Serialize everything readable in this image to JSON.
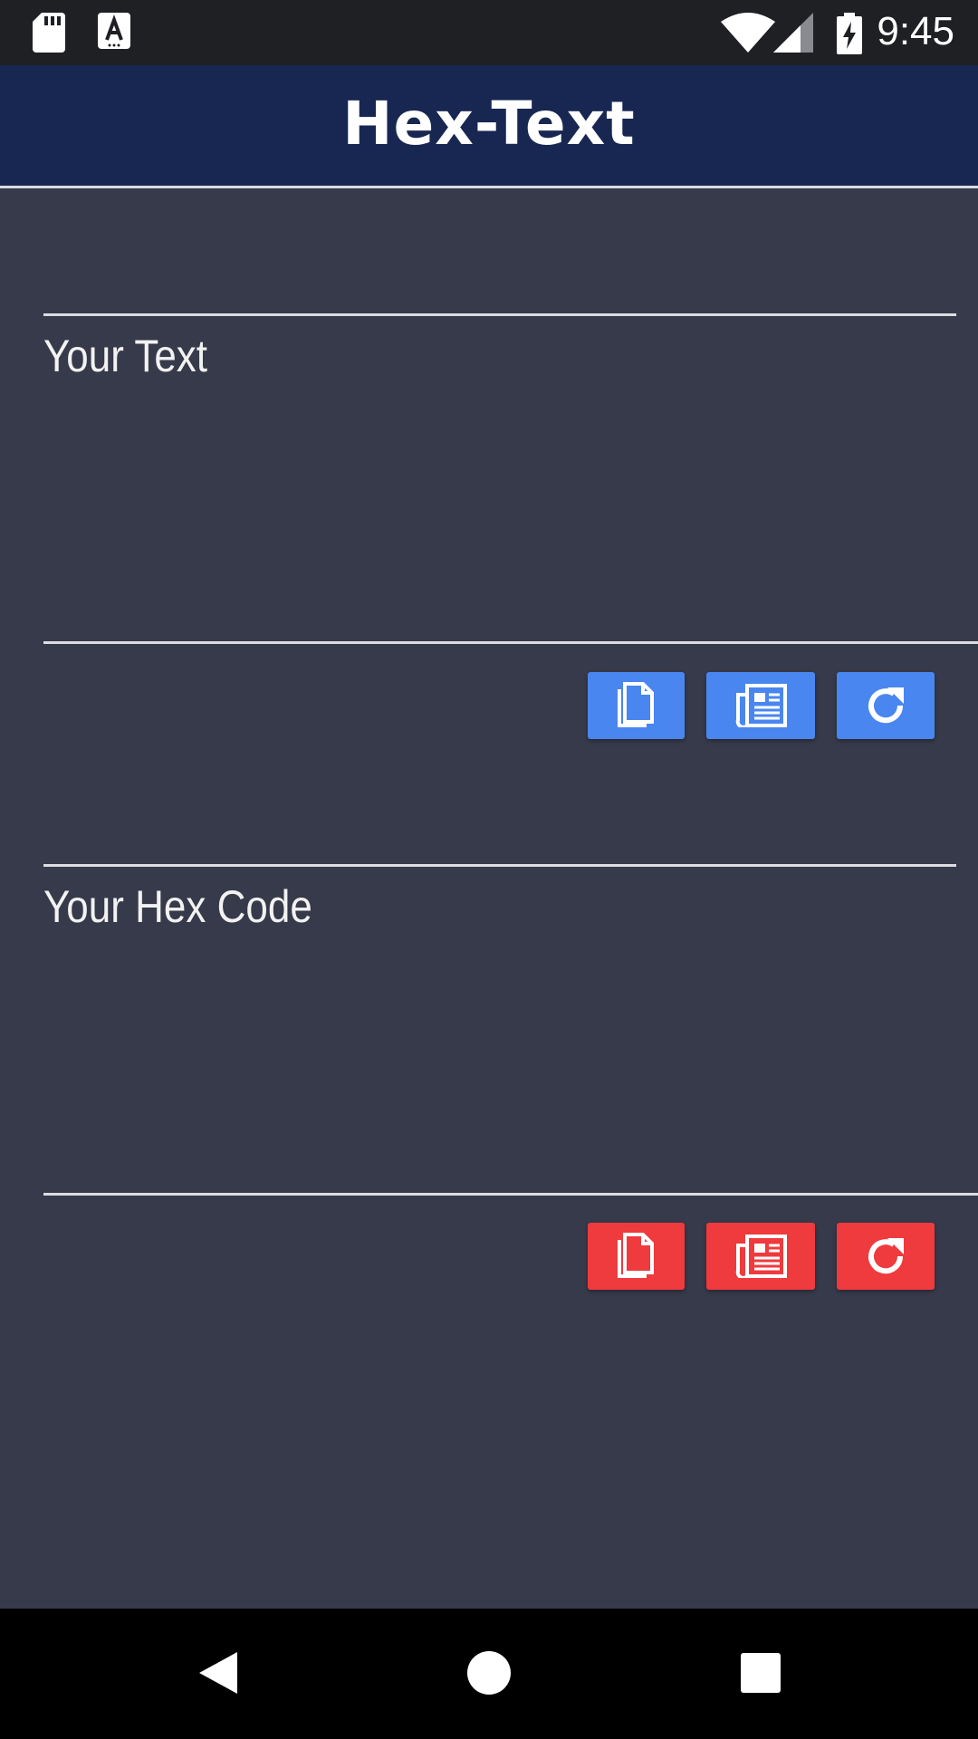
{
  "status_bar": {
    "time": "9:45",
    "icons": [
      "sd-card-icon",
      "keyboard-a-icon",
      "wifi-icon",
      "signal-icon",
      "battery-charging-icon"
    ]
  },
  "app": {
    "title": "Hex-Text"
  },
  "text_field": {
    "label": "Your Text",
    "value": ""
  },
  "hex_field": {
    "label": "Your Hex Code",
    "value": ""
  },
  "colors": {
    "text_buttons": "#4a86f0",
    "hex_buttons": "#ef3a3e",
    "background": "#373a4a",
    "app_bar": "#182752"
  },
  "actions": {
    "text": [
      "copy-icon",
      "paste-icon",
      "reset-icon"
    ],
    "hex": [
      "copy-icon",
      "paste-icon",
      "reset-icon"
    ]
  },
  "navigation": [
    "back-icon",
    "home-icon",
    "recents-icon"
  ]
}
